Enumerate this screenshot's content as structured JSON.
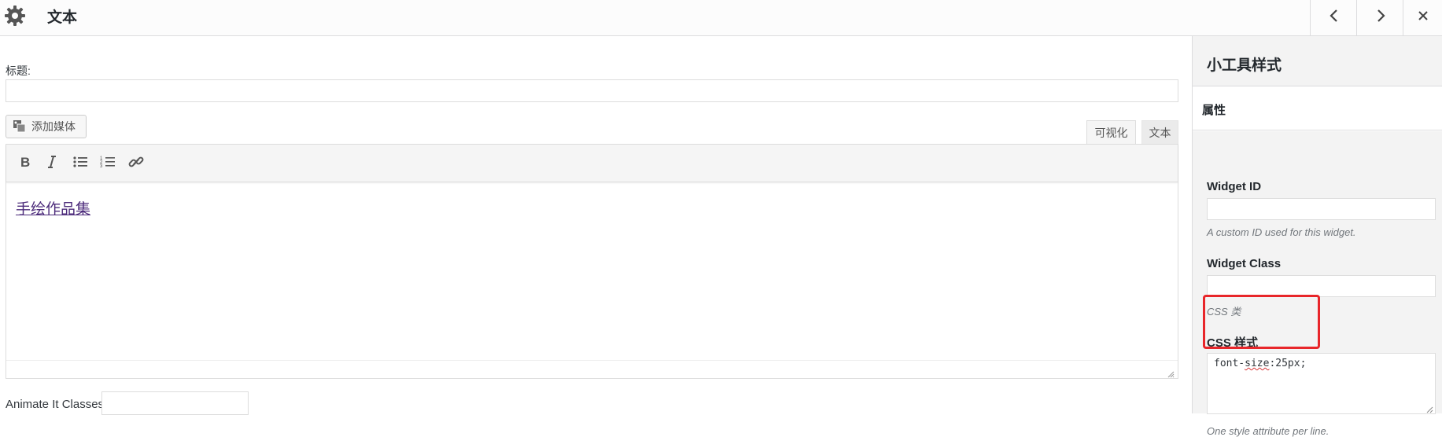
{
  "header": {
    "title": "文本",
    "icons": {
      "settings": "gear-icon",
      "prev": "chevron-left-icon",
      "next": "chevron-right-icon",
      "close": "close-icon"
    }
  },
  "editor": {
    "title_label": "标题:",
    "title_value": "",
    "add_media_label": "添加媒体",
    "tabs": [
      {
        "label": "可视化"
      },
      {
        "label": "文本"
      }
    ],
    "toolbar_icons": [
      "bold-icon",
      "italic-icon",
      "bulleted-list-icon",
      "numbered-list-icon",
      "link-icon"
    ],
    "content_text": "手绘作品集",
    "animate_label": "Animate It Classes",
    "animate_value": ""
  },
  "panel": {
    "title": "小工具样式",
    "section": "属性",
    "fields": {
      "widget_id": {
        "label": "Widget ID",
        "value": "",
        "desc": "A custom ID used for this widget."
      },
      "widget_class": {
        "label": "Widget Class",
        "value": "",
        "desc": "CSS 类"
      },
      "css_style": {
        "label": "CSS 样式",
        "value_prefix": "font-",
        "value_marked": "size",
        "value_suffix": ":25px;",
        "desc": "One style attribute per line."
      }
    }
  },
  "colors": {
    "highlight": "#e8262a",
    "content_link": "#4b2a7a"
  }
}
